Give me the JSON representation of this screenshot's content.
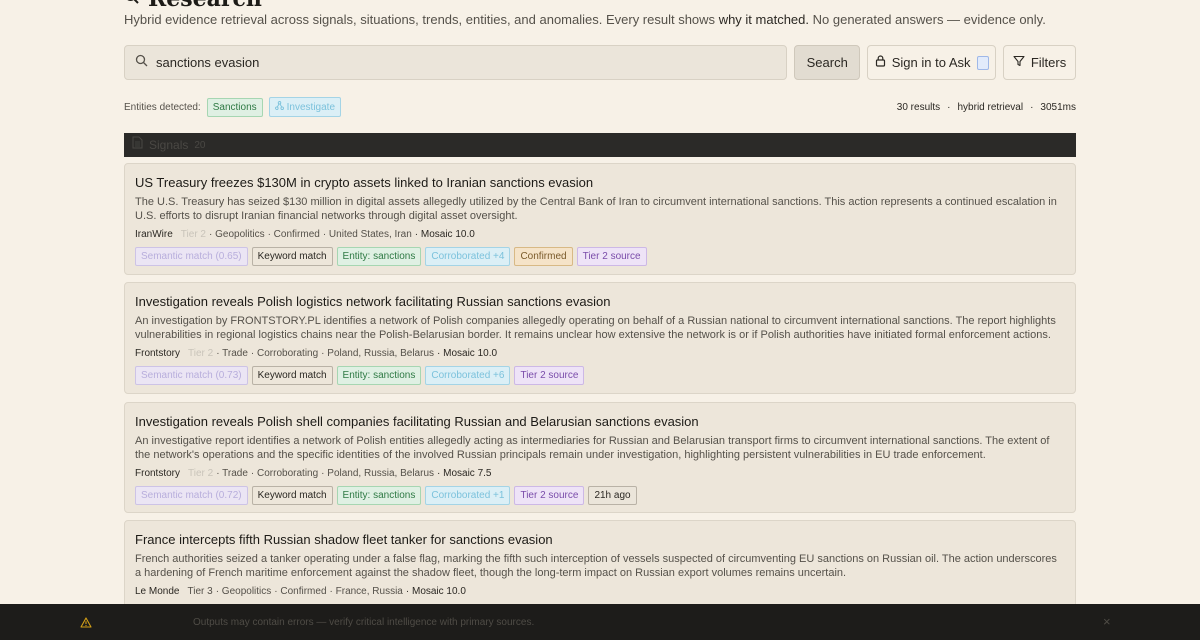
{
  "header": {
    "title": "Research",
    "subtitle_pre": "Hybrid evidence retrieval across signals, situations, trends, entities, and anomalies. Every result shows",
    "subtitle_bold": "why it matched.",
    "subtitle_post": "No generated answers — evidence only."
  },
  "search": {
    "value": "sanctions evasion",
    "button_label": "Search",
    "signin_label": "Sign in to Ask",
    "filters_label": "Filters"
  },
  "entities": {
    "label": "Entities detected:",
    "chips": [
      "Sanctions",
      "Investigate"
    ]
  },
  "results_meta": {
    "count": "30 results",
    "mode": "hybrid retrieval",
    "time": "3051ms",
    "separator": "·"
  },
  "section": {
    "label": "Signals",
    "count": "20"
  },
  "results": [
    {
      "title": "US Treasury freezes $130M in crypto assets linked to Iranian sanctions evasion",
      "description": "The U.S. Treasury has seized $130 million in digital assets allegedly utilized by the Central Bank of Iran to circumvent international sanctions. This action represents a continued escalation in U.S. efforts to disrupt Iranian financial networks through digital asset oversight.",
      "source": "IranWire",
      "tier": "Tier 2",
      "category": "· Geopolitics",
      "status": "· Confirmed",
      "regions": "· United States, Iran",
      "mosaic": "· Mosaic 10.0",
      "tags": [
        "Semantic match (0.65)",
        "Keyword match",
        "Entity: sanctions",
        "Corroborated +4",
        "Confirmed",
        "Tier 2 source"
      ]
    },
    {
      "title": "Investigation reveals Polish logistics network facilitating Russian sanctions evasion",
      "description": "An investigation by FRONTSTORY.PL identifies a network of Polish companies allegedly operating on behalf of a Russian national to circumvent international sanctions. The report highlights vulnerabilities in regional logistics chains near the Polish-Belarusian border. It remains unclear how extensive the network is or if Polish authorities have initiated formal enforcement actions.",
      "source": "Frontstory",
      "tier": "Tier 2",
      "category": "· Trade",
      "status": "· Corroborating",
      "regions": "· Poland, Russia, Belarus",
      "mosaic": "· Mosaic 10.0",
      "tags": [
        "Semantic match (0.73)",
        "Keyword match",
        "Entity: sanctions",
        "Corroborated +6",
        "Tier 2 source"
      ]
    },
    {
      "title": "Investigation reveals Polish shell companies facilitating Russian and Belarusian sanctions evasion",
      "description": "An investigative report identifies a network of Polish entities allegedly acting as intermediaries for Russian and Belarusian transport firms to circumvent international sanctions. The extent of the network's operations and the specific identities of the involved Russian principals remain under investigation, highlighting persistent vulnerabilities in EU trade enforcement.",
      "source": "Frontstory",
      "tier": "Tier 2",
      "category": "· Trade",
      "status": "· Corroborating",
      "regions": "· Poland, Russia, Belarus",
      "mosaic": "· Mosaic 7.5",
      "tags": [
        "Semantic match (0.72)",
        "Keyword match",
        "Entity: sanctions",
        "Corroborated +1",
        "Tier 2 source",
        "21h ago"
      ]
    },
    {
      "title": "France intercepts fifth Russian shadow fleet tanker for sanctions evasion",
      "description": "French authorities seized a tanker operating under a false flag, marking the fifth such interception of vessels suspected of circumventing EU sanctions on Russian oil. The action underscores a hardening of French maritime enforcement against the shadow fleet, though the long-term impact on Russian export volumes remains uncertain.",
      "source": "Le Monde",
      "tier": "Tier 3",
      "category": "· Geopolitics",
      "status": "· Confirmed",
      "regions": "· France, Russia",
      "mosaic": "· Mosaic 10.0",
      "tags": []
    }
  ],
  "footer": {
    "text": "Outputs may contain errors — verify critical intelligence with primary sources.",
    "close": "×"
  },
  "colors": {
    "background": "#f7f1e7",
    "card": "#ede6da",
    "section_bar": "#2b2a28",
    "footer": "#1d1c1a"
  }
}
